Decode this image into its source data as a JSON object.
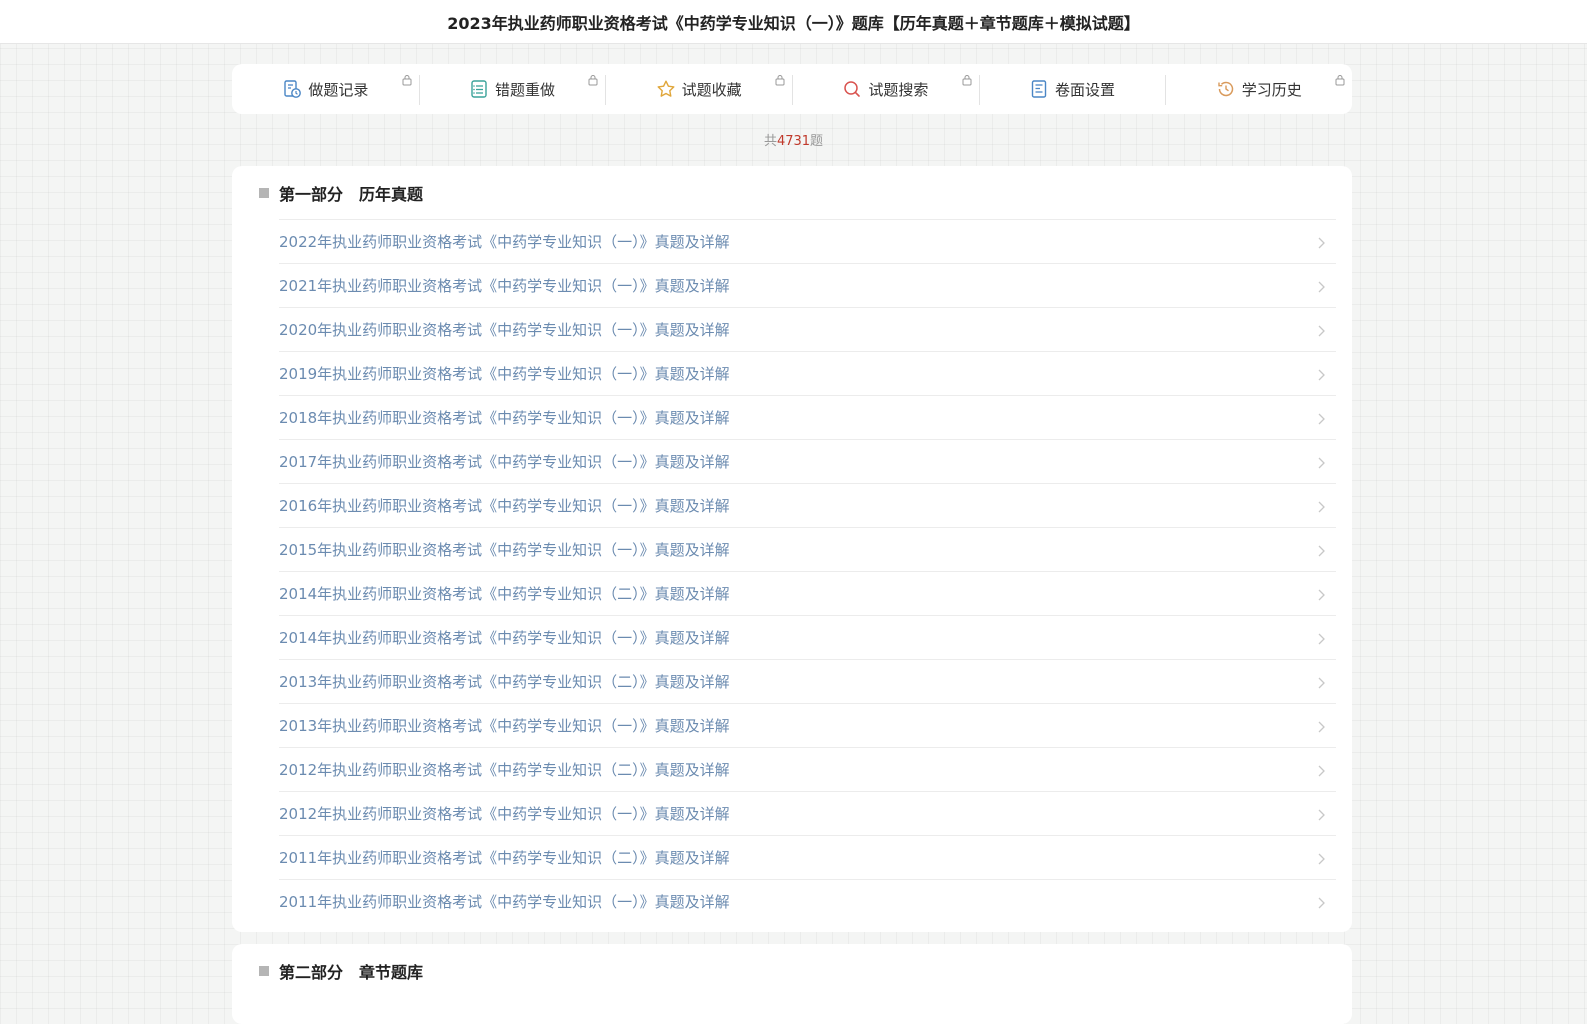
{
  "header": {
    "title": "2023年执业药师职业资格考试《中药学专业知识（一）》题库【历年真题＋章节题库＋模拟试题】"
  },
  "toolbar": {
    "items": [
      {
        "label": "做题记录",
        "icon": "record-icon",
        "locked": true
      },
      {
        "label": "错题重做",
        "icon": "redo-list-icon",
        "locked": true
      },
      {
        "label": "试题收藏",
        "icon": "star-icon",
        "locked": true
      },
      {
        "label": "试题搜索",
        "icon": "search-icon",
        "locked": true
      },
      {
        "label": "卷面设置",
        "icon": "settings-doc-icon",
        "locked": false
      },
      {
        "label": "学习历史",
        "icon": "history-icon",
        "locked": true
      }
    ]
  },
  "summary": {
    "prefix": "共",
    "total": "4731",
    "suffix": "题"
  },
  "sections": [
    {
      "title": "第一部分　历年真题",
      "items": [
        "2022年执业药师职业资格考试《中药学专业知识（一）》真题及详解",
        "2021年执业药师职业资格考试《中药学专业知识（一）》真题及详解",
        "2020年执业药师职业资格考试《中药学专业知识（一）》真题及详解",
        "2019年执业药师职业资格考试《中药学专业知识（一）》真题及详解",
        "2018年执业药师职业资格考试《中药学专业知识（一）》真题及详解",
        "2017年执业药师职业资格考试《中药学专业知识（一）》真题及详解",
        "2016年执业药师职业资格考试《中药学专业知识（一）》真题及详解",
        "2015年执业药师职业资格考试《中药学专业知识（一）》真题及详解",
        "2014年执业药师职业资格考试《中药学专业知识（二）》真题及详解",
        "2014年执业药师职业资格考试《中药学专业知识（一）》真题及详解",
        "2013年执业药师职业资格考试《中药学专业知识（二）》真题及详解",
        "2013年执业药师职业资格考试《中药学专业知识（一）》真题及详解",
        "2012年执业药师职业资格考试《中药学专业知识（二）》真题及详解",
        "2012年执业药师职业资格考试《中药学专业知识（一）》真题及详解",
        "2011年执业药师职业资格考试《中药学专业知识（二）》真题及详解",
        "2011年执业药师职业资格考试《中药学专业知识（一）》真题及详解"
      ]
    },
    {
      "title": "第二部分　章节题库",
      "items": []
    }
  ],
  "colors": {
    "link": "#6b8bb0",
    "count_highlight": "#c0392b",
    "icon_blue": "#4a86c5",
    "icon_teal": "#3aa39a",
    "icon_gold": "#e0a63a",
    "icon_red": "#d9534f",
    "icon_orange": "#d99a5b"
  }
}
